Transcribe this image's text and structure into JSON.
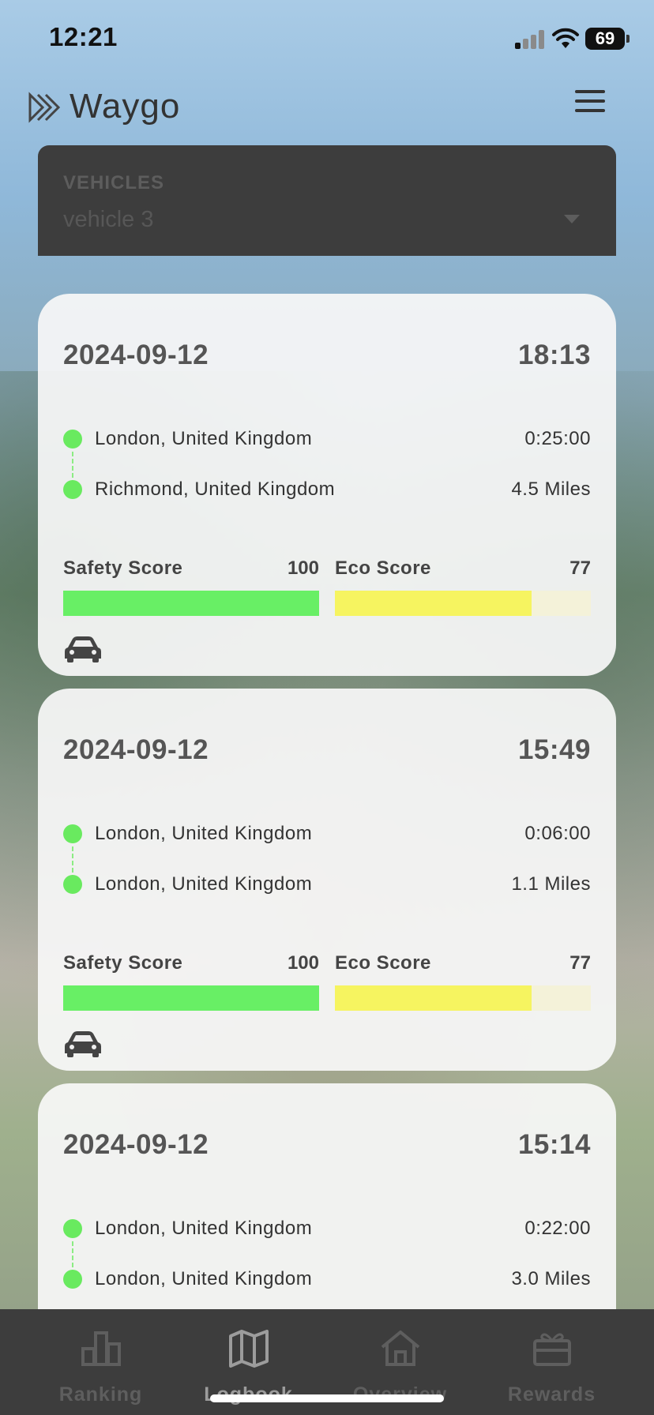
{
  "status_bar": {
    "time": "12:21",
    "battery": "69"
  },
  "header": {
    "title": "Waygo"
  },
  "vehicles": {
    "label": "VEHICLES",
    "selected": "vehicle 3"
  },
  "trips": [
    {
      "date": "2024-09-12",
      "time": "18:13",
      "from": "London, United Kingdom",
      "to": "Richmond, United Kingdom",
      "duration": "0:25:00",
      "distance": "4.5 Miles",
      "safety_label": "Safety Score",
      "safety": "100",
      "safety_fraction": 1.0,
      "eco_label": "Eco Score",
      "eco": "77",
      "eco_fraction": 0.77
    },
    {
      "date": "2024-09-12",
      "time": "15:49",
      "from": "London, United Kingdom",
      "to": "London, United Kingdom",
      "duration": "0:06:00",
      "distance": "1.1 Miles",
      "safety_label": "Safety Score",
      "safety": "100",
      "safety_fraction": 1.0,
      "eco_label": "Eco Score",
      "eco": "77",
      "eco_fraction": 0.77
    },
    {
      "date": "2024-09-12",
      "time": "15:14",
      "from": "London, United Kingdom",
      "to": "London, United Kingdom",
      "duration": "0:22:00",
      "distance": "3.0 Miles"
    }
  ],
  "nav": {
    "items": [
      {
        "label": "Ranking",
        "icon": "bar-chart-icon"
      },
      {
        "label": "Logbook",
        "icon": "map-icon"
      },
      {
        "label": "Overview",
        "icon": "home-icon"
      },
      {
        "label": "Rewards",
        "icon": "gift-icon"
      }
    ],
    "active": "Logbook"
  }
}
